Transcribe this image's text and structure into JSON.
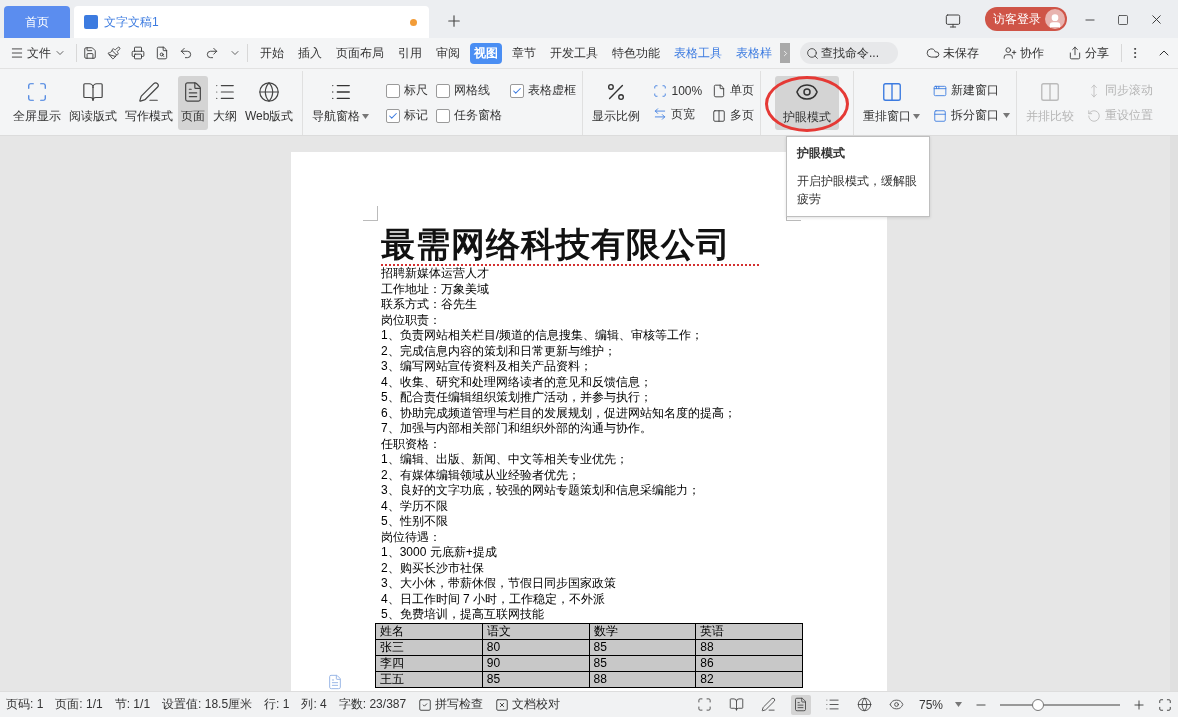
{
  "tabs": [
    {
      "label": "首页",
      "kind": "home",
      "selected": false
    },
    {
      "label": "文字文稿1",
      "kind": "doc",
      "selected": true
    }
  ],
  "account": {
    "login": "访客登录"
  },
  "menu": {
    "file": "文件",
    "tabs": [
      {
        "label": "开始",
        "kind": "main",
        "selected": false
      },
      {
        "label": "插入",
        "kind": "main",
        "selected": false
      },
      {
        "label": "页面布局",
        "kind": "main",
        "selected": false
      },
      {
        "label": "引用",
        "kind": "main",
        "selected": false
      },
      {
        "label": "审阅",
        "kind": "main",
        "selected": false
      },
      {
        "label": "视图",
        "kind": "main",
        "selected": true
      },
      {
        "label": "章节",
        "kind": "main",
        "selected": false
      },
      {
        "label": "开发工具",
        "kind": "main",
        "selected": false
      },
      {
        "label": "特色功能",
        "kind": "main",
        "selected": false
      },
      {
        "label": "表格工具",
        "kind": "context",
        "selected": false
      },
      {
        "label": "表格样",
        "kind": "context",
        "selected": false
      }
    ],
    "search": {
      "placeholder": "查找命令..."
    },
    "actions": [
      {
        "label": "未保存",
        "kind": "cloud"
      },
      {
        "label": "协作",
        "kind": "user"
      },
      {
        "label": "分享",
        "kind": "share"
      }
    ]
  },
  "ribbon": {
    "views": [
      {
        "label": "全屏显示",
        "kind": "fullscreen",
        "selected": false
      },
      {
        "label": "阅读版式",
        "kind": "read",
        "selected": false
      },
      {
        "label": "写作模式",
        "kind": "write",
        "selected": false
      },
      {
        "label": "页面",
        "kind": "page",
        "selected": true
      },
      {
        "label": "大纲",
        "kind": "outline",
        "selected": false
      },
      {
        "label": "Web版式",
        "kind": "web",
        "selected": false
      }
    ],
    "navigation": "导航窗格",
    "checkboxes": [
      {
        "label": "标尺",
        "checked": false
      },
      {
        "label": "网格线",
        "checked": false
      },
      {
        "label": "表格虚框",
        "checked": true
      },
      {
        "label": "标记",
        "checked": true
      },
      {
        "label": "任务窗格",
        "checked": false
      }
    ],
    "zoom": "显示比例",
    "zoom_options": [
      {
        "label": "100%",
        "kind": "actual"
      },
      {
        "label": "页宽",
        "kind": "width"
      },
      {
        "label": "单页",
        "kind": "single"
      },
      {
        "label": "多页",
        "kind": "multi"
      }
    ],
    "eye_care": {
      "label": "护眼模式",
      "highlighted": true
    },
    "rearrange": "重排窗口",
    "window_options": [
      {
        "label": "新建窗口",
        "kind": "new"
      },
      {
        "label": "拆分窗口",
        "kind": "split"
      }
    ],
    "compare": {
      "label": "并排比较",
      "disabled": true
    },
    "compare_options": [
      {
        "label": "同步滚动",
        "disabled": true
      },
      {
        "label": "重设位置",
        "disabled": true
      }
    ]
  },
  "tooltip": {
    "title": "护眼模式",
    "text": "开启护眼模式，缓解眼疲劳"
  },
  "document": {
    "title": "最需网络科技有限公司",
    "lines": [
      "招聘新媒体运营人才",
      "工作地址：万象美域",
      "联系方式：谷先生",
      "岗位职责：",
      "1、负责网站相关栏目/频道的信息搜集、编辑、审核等工作；",
      "2、完成信息内容的策划和日常更新与维护；",
      "3、编写网站宣传资料及相关产品资料；",
      "4、收集、研究和处理网络读者的意见和反馈信息；",
      "5、配合责任编辑组织策划推广活动，并参与执行；",
      "6、协助完成频道管理与栏目的发展规划，促进网站知名度的提高；",
      "7、加强与内部相关部门和组织外部的沟通与协作。",
      "任职资格：",
      "1、编辑、出版、新闻、中文等相关专业优先；",
      "2、有媒体编辑领域从业经验者优先；",
      "3、良好的文字功底，较强的网站专题策划和信息采编能力；",
      "4、学历不限",
      "5、性别不限",
      "岗位待遇：",
      "1、3000 元底薪+提成",
      "2、购买长沙市社保",
      "3、大小休，带薪休假，节假日同步国家政策",
      "4、日工作时间 7 小时，工作稳定，不外派",
      "5、免费培训，提高互联网技能"
    ],
    "table": {
      "columns": [
        "姓名",
        "语文",
        "数学",
        "英语"
      ],
      "rows": [
        [
          "张三",
          "80",
          "85",
          "88"
        ],
        [
          "李四",
          "90",
          "85",
          "86"
        ],
        [
          "王五",
          "85",
          "88",
          "82"
        ]
      ]
    }
  },
  "status_bar": {
    "items": [
      "页码: 1",
      "页面: 1/1",
      "节: 1/1",
      "设置值: 18.5厘米",
      "行: 1",
      "列: 4",
      "字数: 23/387"
    ],
    "spell_check": "拼写检查",
    "proofread": "文档校对",
    "view_modes": [
      {
        "kind": "fullscreen",
        "selected": false
      },
      {
        "kind": "read",
        "selected": false
      },
      {
        "kind": "write",
        "selected": false
      },
      {
        "kind": "page",
        "selected": true
      },
      {
        "kind": "outline",
        "selected": false
      },
      {
        "kind": "web",
        "selected": false
      },
      {
        "kind": "eye",
        "selected": false
      }
    ],
    "zoom": "75%",
    "level": 0.3
  }
}
